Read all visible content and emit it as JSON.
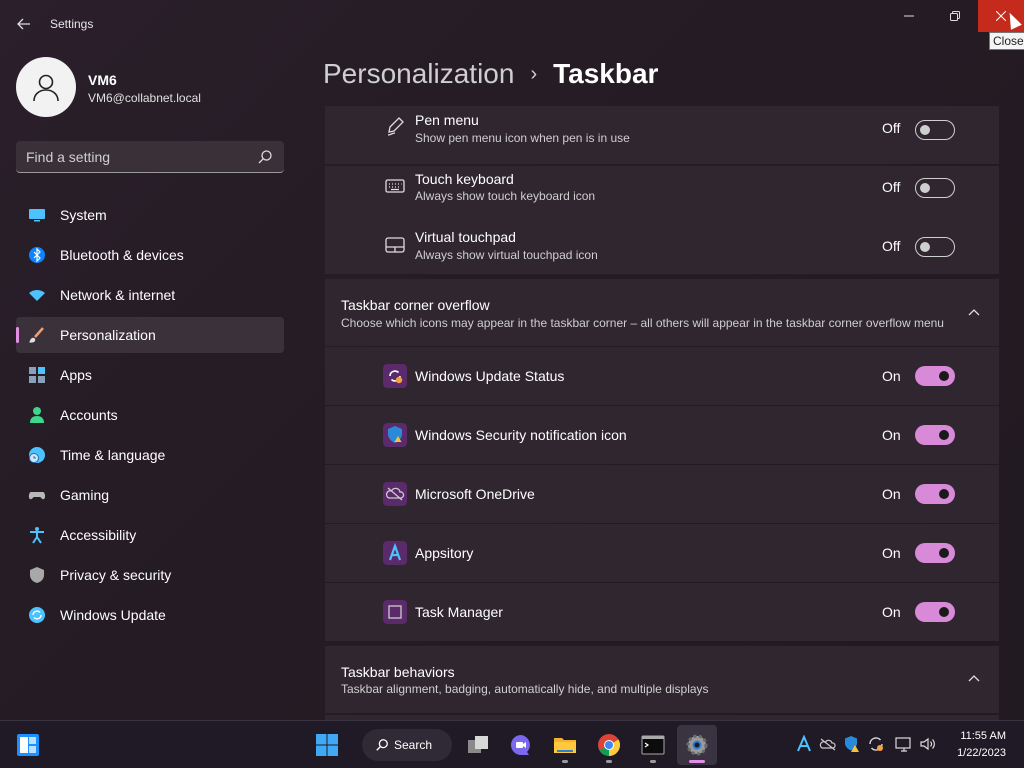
{
  "window": {
    "title": "Settings",
    "tooltip": "Close"
  },
  "profile": {
    "name": "VM6",
    "email": "VM6@collabnet.local"
  },
  "search": {
    "placeholder": "Find a setting"
  },
  "nav": {
    "items": [
      {
        "label": "System",
        "icon": "monitor-icon"
      },
      {
        "label": "Bluetooth & devices",
        "icon": "bluetooth-icon"
      },
      {
        "label": "Network & internet",
        "icon": "wifi-icon"
      },
      {
        "label": "Personalization",
        "icon": "brush-icon",
        "active": true
      },
      {
        "label": "Apps",
        "icon": "apps-icon"
      },
      {
        "label": "Accounts",
        "icon": "person-icon"
      },
      {
        "label": "Time & language",
        "icon": "clock-globe-icon"
      },
      {
        "label": "Gaming",
        "icon": "gamepad-icon"
      },
      {
        "label": "Accessibility",
        "icon": "accessibility-icon"
      },
      {
        "label": "Privacy & security",
        "icon": "shield-icon"
      },
      {
        "label": "Windows Update",
        "icon": "update-icon"
      }
    ]
  },
  "breadcrumb": {
    "parent": "Personalization",
    "separator": "›",
    "current": "Taskbar"
  },
  "corner_icons": [
    {
      "title": "Pen menu",
      "desc": "Show pen menu icon when pen is in use",
      "state": "Off",
      "icon": "pen-icon"
    },
    {
      "title": "Touch keyboard",
      "desc": "Always show touch keyboard icon",
      "state": "Off",
      "icon": "keyboard-icon"
    },
    {
      "title": "Virtual touchpad",
      "desc": "Always show virtual touchpad icon",
      "state": "Off",
      "icon": "touchpad-icon"
    }
  ],
  "overflow_section": {
    "title": "Taskbar corner overflow",
    "desc": "Choose which icons may appear in the taskbar corner – all others will appear in the taskbar corner overflow menu",
    "items": [
      {
        "title": "Windows Update Status",
        "state": "On",
        "icon": "windows-update-status-icon"
      },
      {
        "title": "Windows Security notification icon",
        "state": "On",
        "icon": "windows-security-icon"
      },
      {
        "title": "Microsoft OneDrive",
        "state": "On",
        "icon": "onedrive-icon"
      },
      {
        "title": "Appsitory",
        "state": "On",
        "icon": "appsitory-icon"
      },
      {
        "title": "Task Manager",
        "state": "On",
        "icon": "task-manager-icon"
      }
    ]
  },
  "behaviors_section": {
    "title": "Taskbar behaviors",
    "desc": "Taskbar alignment, badging, automatically hide, and multiple displays"
  },
  "taskbar": {
    "search_label": "Search",
    "time": "11:55 AM",
    "date": "1/22/2023"
  },
  "colors": {
    "accent": "#e38ee6",
    "toggle_on": "#d88ad8",
    "close_button": "#c42b1c"
  }
}
